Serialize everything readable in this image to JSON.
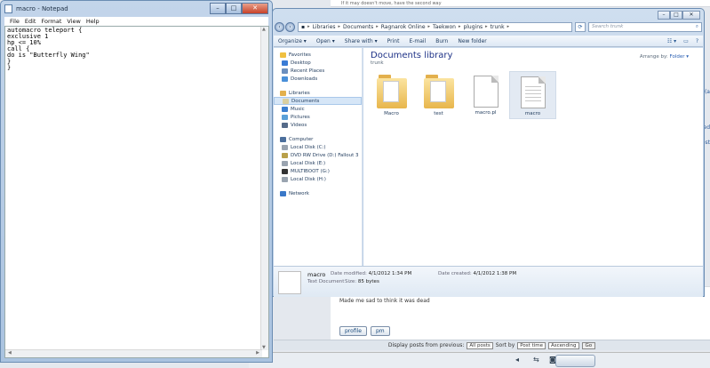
{
  "background": {
    "top_text": "If it may doesn't move, have the second way",
    "post_text": "Made me sad to think it was dead",
    "post_buttons": [
      "profile",
      "pm"
    ],
    "bar_label": "Display posts from previous:",
    "bar_select1": "All posts",
    "bar_sort_label": "Sort by",
    "bar_select2": "Post time",
    "bar_select3": "Ascending",
    "bar_go": "Go",
    "edge1": "(a",
    "edge2": "ed",
    "edge3": "ost"
  },
  "notepad": {
    "title": "macro - Notepad",
    "menu": [
      "File",
      "Edit",
      "Format",
      "View",
      "Help"
    ],
    "content": "automacro teleport {\nexclusive 1\nhp <= 10%\ncall {\ndo is \"Butterfly Wing\"\n}\n}"
  },
  "explorer": {
    "breadcrumb": [
      "Libraries",
      "Documents",
      "Ragnarok Online",
      "Taekwon",
      "plugins",
      "trunk"
    ],
    "search_placeholder": "Search trunk",
    "toolbar": [
      "Organize ▾",
      "Open ▾",
      "Share with ▾",
      "Print",
      "E-mail",
      "Burn",
      "New folder"
    ],
    "nav": {
      "favorites": "Favorites",
      "favorites_items": [
        "Desktop",
        "Recent Places",
        "Downloads"
      ],
      "libraries": "Libraries",
      "libraries_items": [
        "Documents",
        "Music",
        "Pictures",
        "Videos"
      ],
      "computer": "Computer",
      "computer_items": [
        "Local Disk (C:)",
        "DVD RW Drive (D:) Fallout 3",
        "Local Disk (E:)",
        "MULTIBOOT (G:)",
        "Local Disk (H:)"
      ],
      "network": "Network"
    },
    "library_title": "Documents library",
    "library_sub": "trunk",
    "arrange_label": "Arrange by:",
    "arrange_value": "Folder ▾",
    "files": [
      "Macro",
      "test",
      "macro.pl",
      "macro"
    ],
    "details": {
      "name": "macro",
      "type": "Text Document",
      "modified_label": "Date modified:",
      "modified": "4/1/2012 1:34 PM",
      "size_label": "Size:",
      "size": "85 bytes",
      "created_label": "Date created:",
      "created": "4/1/2012 1:38 PM"
    }
  }
}
